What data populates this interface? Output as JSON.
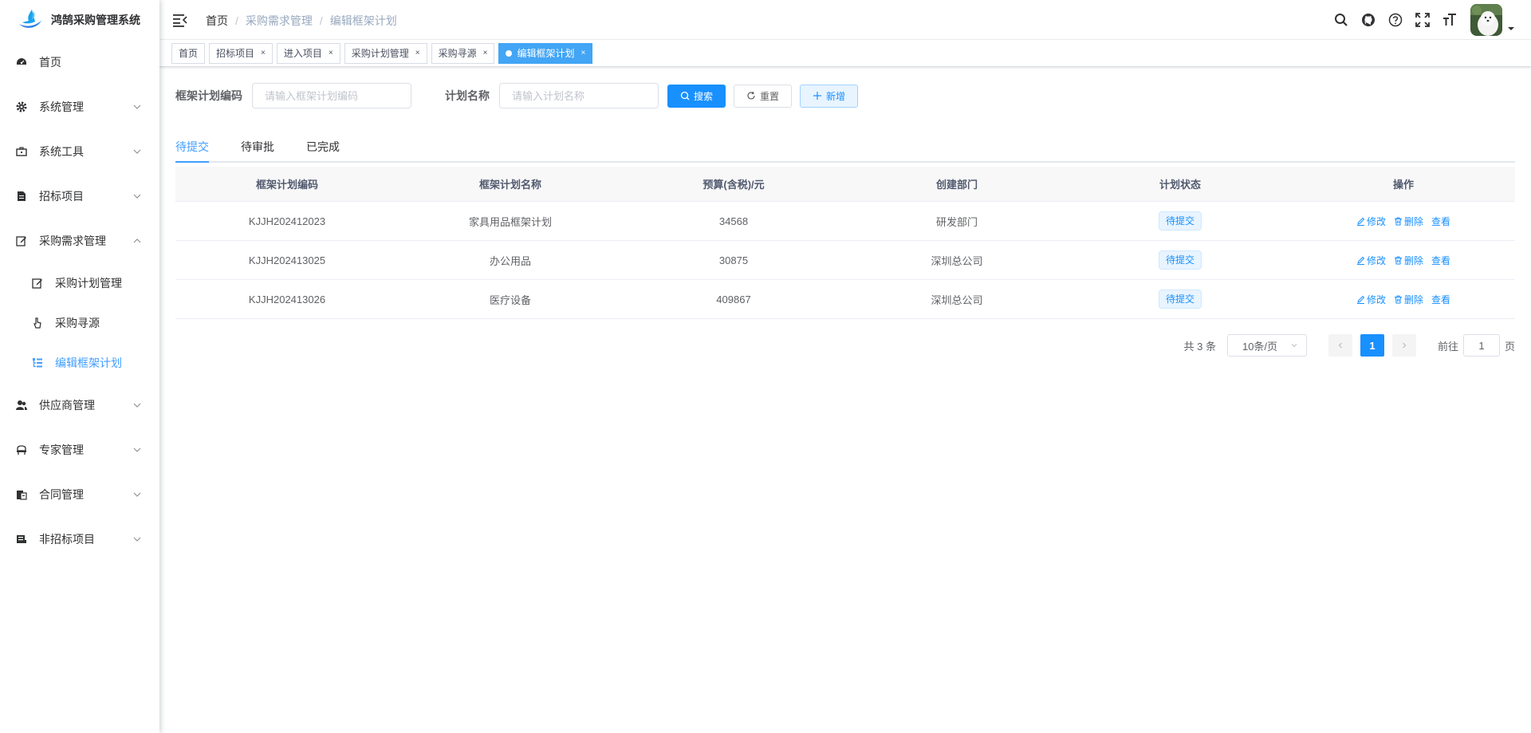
{
  "app": {
    "title": "鸿鹄采购管理系统"
  },
  "sidebar": {
    "items": [
      {
        "label": "首页",
        "icon": "dashboard-icon"
      },
      {
        "label": "系统管理",
        "icon": "gear-icon"
      },
      {
        "label": "系统工具",
        "icon": "toolbox-icon"
      },
      {
        "label": "招标项目",
        "icon": "document-icon"
      },
      {
        "label": "采购需求管理",
        "icon": "edit-icon",
        "expanded": true,
        "children": [
          {
            "label": "采购计划管理",
            "icon": "edit-icon"
          },
          {
            "label": "采购寻源",
            "icon": "pointer-icon"
          },
          {
            "label": "编辑框架计划",
            "icon": "tree-table-icon",
            "active": true
          }
        ]
      },
      {
        "label": "供应商管理",
        "icon": "peoples-icon"
      },
      {
        "label": "专家管理",
        "icon": "expert-icon"
      },
      {
        "label": "合同管理",
        "icon": "clipboard-icon"
      },
      {
        "label": "非招标项目",
        "icon": "server-icon"
      }
    ]
  },
  "breadcrumb": [
    "首页",
    "采购需求管理",
    "编辑框架计划"
  ],
  "tags": [
    {
      "label": "首页",
      "closable": false
    },
    {
      "label": "招标项目",
      "closable": true
    },
    {
      "label": "进入项目",
      "closable": true
    },
    {
      "label": "采购计划管理",
      "closable": true
    },
    {
      "label": "采购寻源",
      "closable": true
    },
    {
      "label": "编辑框架计划",
      "closable": true,
      "active": true
    }
  ],
  "tag_close_glyph": "×",
  "search": {
    "code_label": "框架计划编码",
    "code_placeholder": "请输入框架计划编码",
    "name_label": "计划名称",
    "name_placeholder": "请输入计划名称",
    "search_btn": "搜索",
    "reset_btn": "重置",
    "add_btn": "新增"
  },
  "tabs": [
    "待提交",
    "待审批",
    "已完成"
  ],
  "table": {
    "columns": [
      "框架计划编码",
      "框架计划名称",
      "预算(含税)/元",
      "创建部门",
      "计划状态",
      "操作"
    ],
    "rows": [
      {
        "code": "KJJH202412023",
        "name": "家具用品框架计划",
        "budget": "34568",
        "dept": "研发部门",
        "status": "待提交"
      },
      {
        "code": "KJJH202413025",
        "name": "办公用品",
        "budget": "30875",
        "dept": "深圳总公司",
        "status": "待提交"
      },
      {
        "code": "KJJH202413026",
        "name": "医疗设备",
        "budget": "409867",
        "dept": "深圳总公司",
        "status": "待提交"
      }
    ],
    "actions": {
      "edit": "修改",
      "delete": "删除",
      "view": "查看"
    }
  },
  "pagination": {
    "total_text": "共 3 条",
    "page_size": "10条/页",
    "current_page": "1",
    "goto_label": "前往",
    "goto_value": "1",
    "page_suffix": "页"
  },
  "colors": {
    "primary": "#1890ff",
    "active_tag": "#42a5f5",
    "link": "#409eff"
  }
}
